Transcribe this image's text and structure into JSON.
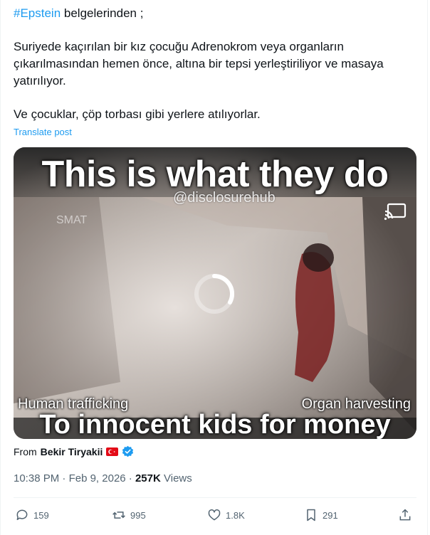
{
  "post": {
    "hashtag": "#Epstein",
    "line1_rest": " belgelerinden ;",
    "paragraph1": "Suriyede kaçırılan bir kız çocuğu Adrenokrom veya organların çıkarılmasından hemen önce, altına bir tepsi yerleştiriliyor ve masaya yatırılıyor.",
    "paragraph2": "Ve çocuklar, çöp torbası gibi yerlere atılıyorlar.",
    "translate_label": "Translate post"
  },
  "video": {
    "headline": "This is what they do",
    "watermark": "@disclosurehub",
    "corner_mark": "SMAT",
    "label_left": "Human trafficking",
    "label_right": "Organ harvesting",
    "subline": "To innocent kids for money"
  },
  "source": {
    "from_label": "From",
    "name": "Bekir Tiryakii"
  },
  "meta": {
    "time": "10:38 PM",
    "date": "Feb 9, 2026",
    "views_count": "257K",
    "views_label": "Views",
    "separator": "·"
  },
  "actions": {
    "replies": "159",
    "reposts": "995",
    "likes": "1.8K",
    "bookmarks": "291"
  },
  "icons": [
    "cast-icon",
    "loading-spinner-icon",
    "turkey-flag-icon",
    "verified-badge-icon",
    "reply-icon",
    "repost-icon",
    "like-icon",
    "bookmark-icon",
    "share-icon"
  ],
  "colors": {
    "accent": "#1d9bf0",
    "text": "#0f1419",
    "muted": "#536471",
    "border": "#eff3f4"
  }
}
